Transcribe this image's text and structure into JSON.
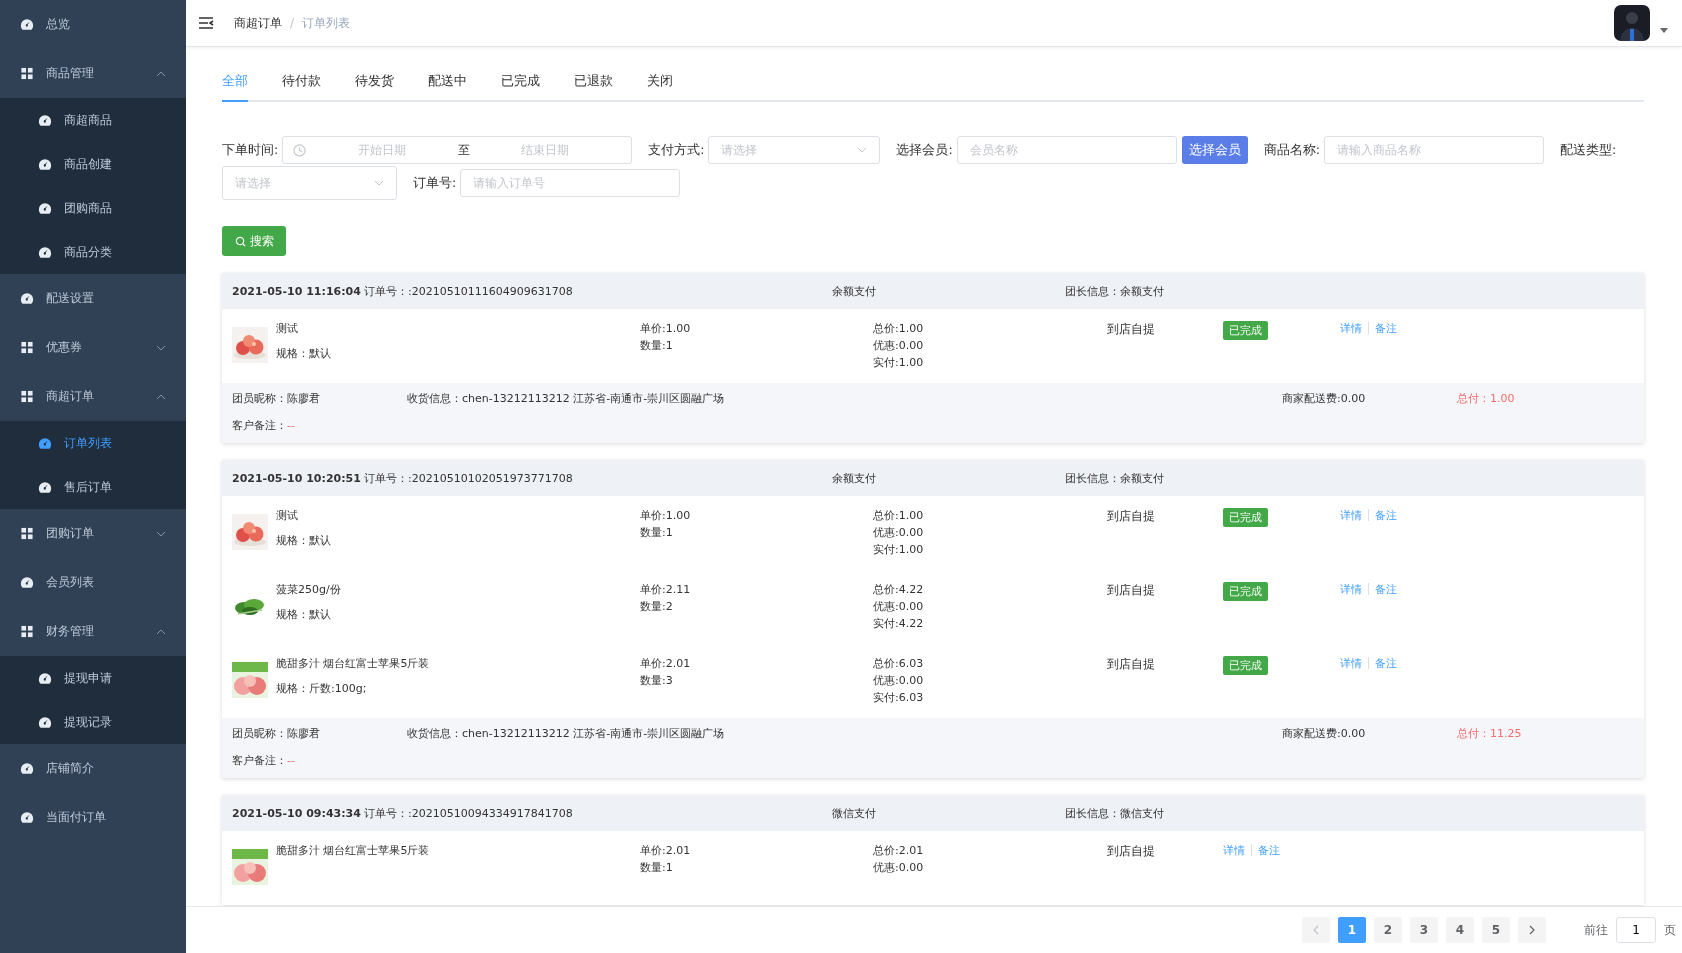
{
  "sidebar": {
    "items": [
      {
        "label": "总览",
        "kind": "leaf",
        "selected": false
      },
      {
        "label": "商品管理",
        "kind": "group",
        "expanded": true,
        "children": [
          {
            "label": "商超商品",
            "selected": false
          },
          {
            "label": "商品创建",
            "selected": false
          },
          {
            "label": "团购商品",
            "selected": false
          },
          {
            "label": "商品分类",
            "selected": false
          }
        ]
      },
      {
        "label": "配送设置",
        "kind": "leaf",
        "selected": false
      },
      {
        "label": "优惠券",
        "kind": "group",
        "expanded": false
      },
      {
        "label": "商超订单",
        "kind": "group",
        "expanded": true,
        "children": [
          {
            "label": "订单列表",
            "selected": true
          },
          {
            "label": "售后订单",
            "selected": false
          }
        ]
      },
      {
        "label": "团购订单",
        "kind": "group",
        "expanded": false
      },
      {
        "label": "会员列表",
        "kind": "leaf",
        "selected": false
      },
      {
        "label": "财务管理",
        "kind": "group",
        "expanded": true,
        "children": [
          {
            "label": "提现申请",
            "selected": false
          },
          {
            "label": "提现记录",
            "selected": false
          }
        ]
      },
      {
        "label": "店铺简介",
        "kind": "leaf",
        "selected": false
      },
      {
        "label": "当面付订单",
        "kind": "leaf",
        "selected": false
      }
    ]
  },
  "breadcrumb": [
    "商超订单",
    "订单列表"
  ],
  "breadcrumb_separator": "/",
  "tabs": [
    {
      "label": "全部",
      "selected": true
    },
    {
      "label": "待付款",
      "selected": false
    },
    {
      "label": "待发货",
      "selected": false
    },
    {
      "label": "配送中",
      "selected": false
    },
    {
      "label": "已完成",
      "selected": false
    },
    {
      "label": "已退款",
      "selected": false
    },
    {
      "label": "关闭",
      "selected": false
    }
  ],
  "filters": {
    "order_time": {
      "label": "下单时间:",
      "start_placeholder": "开始日期",
      "separator": "至",
      "end_placeholder": "结束日期"
    },
    "payment": {
      "label": "支付方式:",
      "placeholder": "请选择"
    },
    "member": {
      "label": "选择会员:",
      "placeholder": "会员名称",
      "button": "选择会员"
    },
    "product": {
      "label": "商品名称:",
      "placeholder": "请输入商品名称"
    },
    "delivery": {
      "label": "配送类型:",
      "placeholder": "请选择"
    },
    "order_no": {
      "label": "订单号:",
      "placeholder": "请输入订单号"
    },
    "search_button": "搜索"
  },
  "orders": [
    {
      "time": "2021-05-10 11:16:04",
      "order_no": "订单号：:20210510111604909631708",
      "payment": "余额支付",
      "leader": "团长信息：余额支付",
      "items": [
        {
          "kind": "apple",
          "name": "测试",
          "spec": "规格：默认",
          "price": "单价:1.00",
          "qty": "数量:1",
          "total": "总价:1.00",
          "discount": "优惠:0.00",
          "paid": "实付:1.00",
          "delivery": "到店自提",
          "status": "已完成",
          "detail": "详情",
          "note": "备注"
        }
      ],
      "nickname": "团员昵称：陈廖君",
      "address": "收货信息：chen-13212113212 江苏省-南通市-崇川区圆融广场",
      "fee": "商家配送费:0.00",
      "sum": "总付：1.00",
      "remark_label": "客户备注：",
      "remark": "--"
    },
    {
      "time": "2021-05-10 10:20:51",
      "order_no": "订单号：:20210510102051973771708",
      "payment": "余额支付",
      "leader": "团长信息：余额支付",
      "items": [
        {
          "kind": "apple",
          "name": "测试",
          "spec": "规格：默认",
          "price": "单价:1.00",
          "qty": "数量:1",
          "total": "总价:1.00",
          "discount": "优惠:0.00",
          "paid": "实付:1.00",
          "delivery": "到店自提",
          "status": "已完成",
          "detail": "详情",
          "note": "备注"
        },
        {
          "kind": "greens",
          "name": "菠菜250g/份",
          "spec": "规格：默认",
          "price": "单价:2.11",
          "qty": "数量:2",
          "total": "总价:4.22",
          "discount": "优惠:0.00",
          "paid": "实付:4.22",
          "delivery": "到店自提",
          "status": "已完成",
          "detail": "详情",
          "note": "备注"
        },
        {
          "kind": "box",
          "name": "脆甜多汁 烟台红富士苹果5斤装",
          "spec": "规格：斤数:100g;",
          "price": "单价:2.01",
          "qty": "数量:3",
          "total": "总价:6.03",
          "discount": "优惠:0.00",
          "paid": "实付:6.03",
          "delivery": "到店自提",
          "status": "已完成",
          "detail": "详情",
          "note": "备注"
        }
      ],
      "nickname": "团员昵称：陈廖君",
      "address": "收货信息：chen-13212113212 江苏省-南通市-崇川区圆融广场",
      "fee": "商家配送费:0.00",
      "sum": "总付：11.25",
      "remark_label": "客户备注：",
      "remark": "--"
    },
    {
      "time": "2021-05-10 09:43:34",
      "order_no": "订单号：:20210510094334917841708",
      "payment": "微信支付",
      "leader": "团长信息：微信支付",
      "items": [
        {
          "kind": "box",
          "name": "脆甜多汁 烟台红富士苹果5斤装",
          "price": "单价:2.01",
          "qty": "数量:1",
          "total": "总价:2.01",
          "discount": "优惠:0.00",
          "delivery": "到店自提",
          "detail": "详情",
          "note": "备注"
        }
      ]
    }
  ],
  "pagination": {
    "pages": [
      {
        "label": "1",
        "selected": true
      },
      {
        "label": "2",
        "selected": false
      },
      {
        "label": "3",
        "selected": false
      },
      {
        "label": "4",
        "selected": false
      },
      {
        "label": "5",
        "selected": false
      }
    ],
    "goto_label": "前往",
    "goto_value": "1",
    "goto_unit": "页"
  }
}
